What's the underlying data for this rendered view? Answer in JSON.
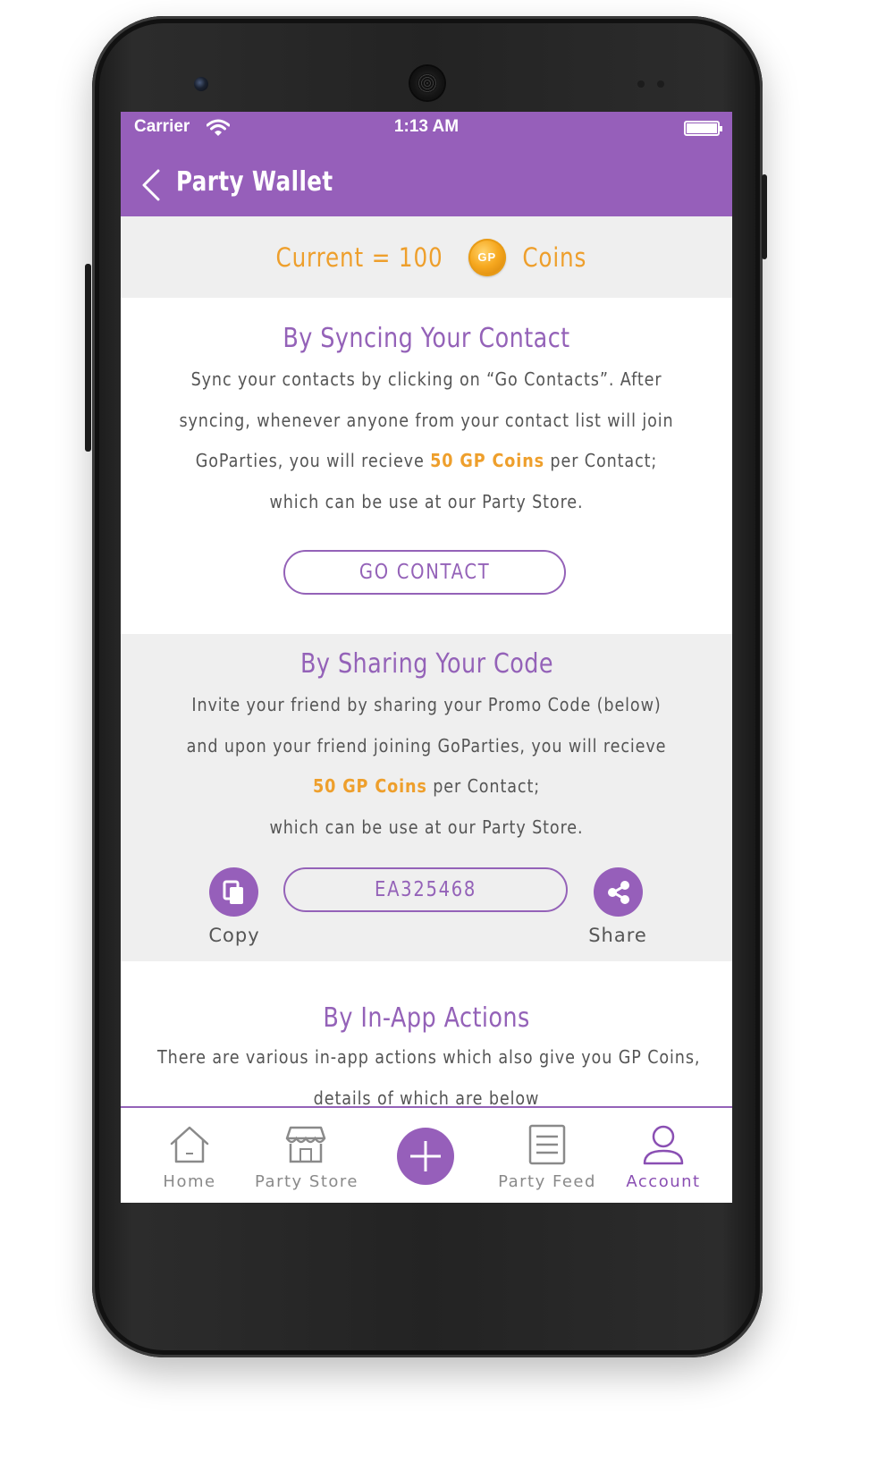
{
  "status_bar": {
    "carrier": "Carrier",
    "time": "1:13 AM"
  },
  "nav": {
    "title": "Party Wallet"
  },
  "balance": {
    "prefix": "Current = 100",
    "coin_text": "GP",
    "suffix": "Coins"
  },
  "sync_section": {
    "heading": "By Syncing Your Contact",
    "line1": "Sync your contacts by clicking on “Go Contacts”. After",
    "line2": "syncing, whenever anyone from your contact list will join",
    "line3_pre": "GoParties, you will recieve ",
    "line3_highlight": "50 GP Coins",
    "line3_post": " per Contact;",
    "line4": "which can be use at our Party Store.",
    "button_label": "GO CONTACT"
  },
  "share_section": {
    "heading": "By Sharing Your Code",
    "line1": "Invite  your friend by sharing your Promo Code (below)",
    "line2": "and upon your friend joining GoParties, you will recieve",
    "line3_highlight": "50 GP Coins",
    "line3_post": " per Contact;",
    "line4": "which can be use at our Party Store.",
    "promo_code": "EA325468",
    "copy_label": "Copy",
    "share_label": "Share"
  },
  "inapp_section": {
    "heading": "By In-App Actions",
    "line1": "There are various in-app actions which also give you GP Coins,",
    "line2": "details of which are below"
  },
  "tabs": [
    {
      "label": "Home",
      "icon": "home-icon"
    },
    {
      "label": "Party Store",
      "icon": "store-icon"
    },
    {
      "label": "",
      "icon": "plus-icon"
    },
    {
      "label": "Party Feed",
      "icon": "feed-icon"
    },
    {
      "label": "Account",
      "icon": "user-icon",
      "active": true
    }
  ],
  "colors": {
    "accent": "#965fba",
    "highlight": "#ee9f2c",
    "background": "#efefef"
  }
}
